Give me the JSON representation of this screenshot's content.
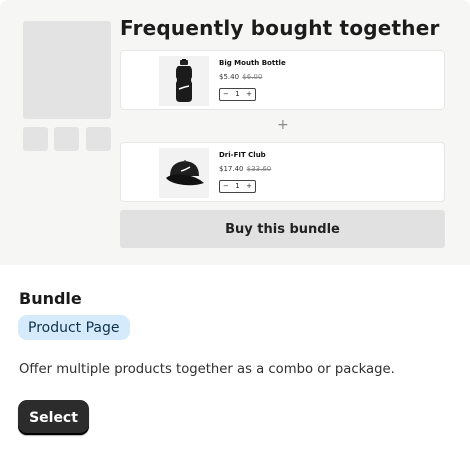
{
  "preview": {
    "title": "Frequently bought together",
    "products": [
      {
        "name": "Big Mouth Bottle",
        "price": "$5.40",
        "old_price": "$6.00",
        "qty": "1",
        "image_icon": "water-bottle-icon"
      },
      {
        "name": "Dri-FIT Club",
        "price": "$17.40",
        "old_price": "$33.60",
        "qty": "1",
        "image_icon": "cap-icon"
      }
    ],
    "qty_minus": "−",
    "qty_plus": "+",
    "separator": "+",
    "buy_label": "Buy this bundle"
  },
  "info": {
    "title": "Bundle",
    "tag": "Product Page",
    "description": "Offer multiple products together as a combo or package.",
    "select_label": "Select"
  },
  "colors": {
    "preview_bg": "#f6f6f5",
    "tag_bg": "#d5ebfb",
    "select_bg": "#2c2c2c"
  }
}
